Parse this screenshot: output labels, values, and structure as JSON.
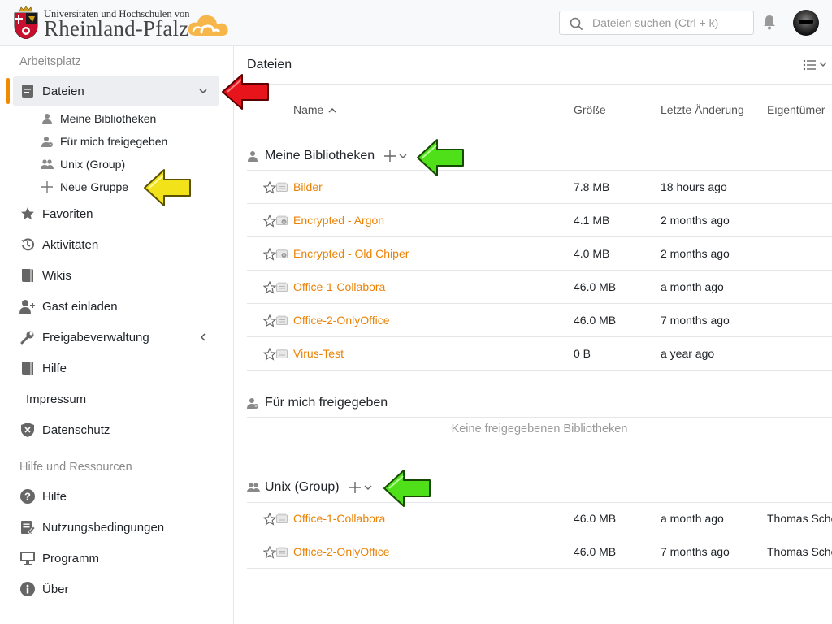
{
  "header": {
    "logo_line1": "Universitäten und Hochschulen von",
    "logo_line2": "Rheinland-Pfalz",
    "search_placeholder": "Dateien suchen (Ctrl + k)",
    "accent": "#f08a00"
  },
  "sidebar": {
    "section1_title": "Arbeitsplatz",
    "files_label": "Dateien",
    "sub_items": [
      {
        "label": "Meine Bibliotheken",
        "icon": "user-icon"
      },
      {
        "label": "Für mich freigegeben",
        "icon": "user-shared-icon"
      },
      {
        "label": "Unix (Group)",
        "icon": "group-icon"
      },
      {
        "label": "Neue Gruppe",
        "icon": "plus-icon"
      }
    ],
    "items": [
      {
        "label": "Favoriten",
        "icon": "star-icon"
      },
      {
        "label": "Aktivitäten",
        "icon": "history-icon"
      },
      {
        "label": "Wikis",
        "icon": "book-icon"
      },
      {
        "label": "Gast einladen",
        "icon": "user-plus-icon"
      },
      {
        "label": "Freigabeverwaltung",
        "icon": "wrench-icon"
      },
      {
        "label": "Hilfe",
        "icon": "book-icon"
      },
      {
        "label": "Impressum",
        "icon": ""
      },
      {
        "label": "Datenschutz",
        "icon": "shield-icon"
      }
    ],
    "section2_title": "Hilfe und Ressourcen",
    "resources": [
      {
        "label": "Hilfe",
        "icon": "question-icon"
      },
      {
        "label": "Nutzungsbedingungen",
        "icon": "edit-doc-icon"
      },
      {
        "label": "Programm",
        "icon": "monitor-icon"
      },
      {
        "label": "Über",
        "icon": "info-icon"
      }
    ]
  },
  "main": {
    "title": "Dateien",
    "columns": {
      "name": "Name",
      "size": "Größe",
      "modified": "Letzte Änderung",
      "owner": "Eigentümer"
    },
    "groups": {
      "my_libraries": {
        "title": "Meine Bibliotheken",
        "rows": [
          {
            "name": "Bilder",
            "size": "7.8 MB",
            "modified": "18 hours ago",
            "owner": "",
            "encrypted": false
          },
          {
            "name": "Encrypted - Argon",
            "size": "4.1 MB",
            "modified": "2 months ago",
            "owner": "",
            "encrypted": true
          },
          {
            "name": "Encrypted - Old Chiper",
            "size": "4.0 MB",
            "modified": "2 months ago",
            "owner": "",
            "encrypted": true
          },
          {
            "name": "Office-1-Collabora",
            "size": "46.0 MB",
            "modified": "a month ago",
            "owner": "",
            "encrypted": false
          },
          {
            "name": "Office-2-OnlyOffice",
            "size": "46.0 MB",
            "modified": "7 months ago",
            "owner": "",
            "encrypted": false
          },
          {
            "name": "Virus-Test",
            "size": "0 B",
            "modified": "a year ago",
            "owner": "",
            "encrypted": false
          }
        ]
      },
      "shared": {
        "title": "Für mich freigegeben",
        "empty_text": "Keine freigegebenen Bibliotheken"
      },
      "unix_group": {
        "title": "Unix (Group)",
        "rows": [
          {
            "name": "Office-1-Collabora",
            "size": "46.0 MB",
            "modified": "a month ago",
            "owner": "Thomas Sche"
          },
          {
            "name": "Office-2-OnlyOffice",
            "size": "46.0 MB",
            "modified": "7 months ago",
            "owner": "Thomas Sche"
          }
        ]
      }
    }
  },
  "annotations": {
    "red_arrow_color": "#e8141c",
    "yellow_arrow_color": "#f2e21a",
    "green_arrow_color": "#4fe01a"
  }
}
